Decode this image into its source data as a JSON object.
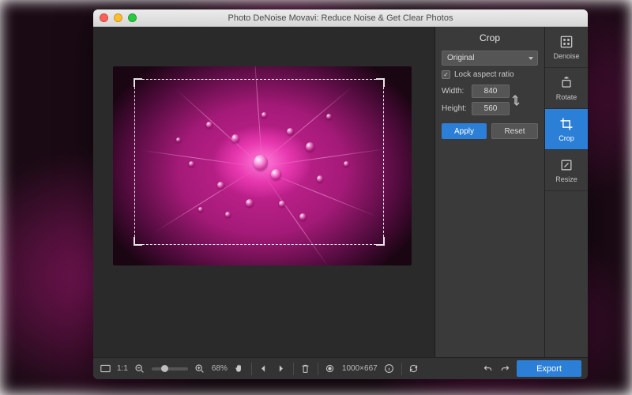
{
  "window": {
    "title": "Photo DeNoise Movavi: Reduce Noise & Get Clear Photos"
  },
  "panel": {
    "title": "Crop",
    "ratio_preset": "Original",
    "lock_label": "Lock aspect ratio",
    "lock_checked": true,
    "width_label": "Width:",
    "width_value": "840",
    "height_label": "Height:",
    "height_value": "560",
    "apply_label": "Apply",
    "reset_label": "Reset"
  },
  "tools": {
    "denoise": "Denoise",
    "rotate": "Rotate",
    "crop": "Crop",
    "resize": "Resize",
    "active": "crop"
  },
  "bottombar": {
    "zoom_ratio_label": "1:1",
    "zoom_percent": "68%",
    "dimensions": "1000×667",
    "export_label": "Export"
  },
  "colors": {
    "accent": "#2b7fd6",
    "panel_bg": "#3a3a3a",
    "canvas_bg": "#2a2a2a"
  }
}
